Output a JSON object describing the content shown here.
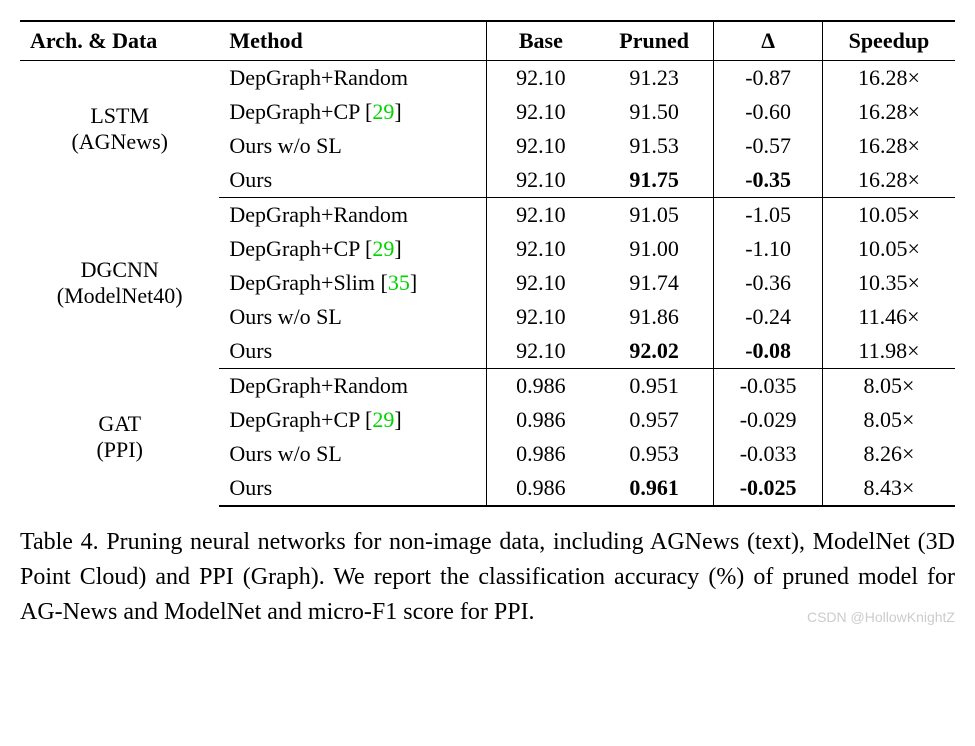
{
  "headers": {
    "arch": "Arch. & Data",
    "method": "Method",
    "base": "Base",
    "pruned": "Pruned",
    "delta": "Δ",
    "speedup": "Speedup"
  },
  "cite29": "29",
  "cite35": "35",
  "groups": [
    {
      "arch_line1": "LSTM",
      "arch_line2": "(AGNews)",
      "rows": [
        {
          "method_pre": "DepGraph+Random",
          "cite": null,
          "method_post": "",
          "base": "92.10",
          "pruned": "91.23",
          "delta": "-0.87",
          "speedup": "16.28×",
          "bold": false
        },
        {
          "method_pre": "DepGraph+CP [",
          "cite": "29",
          "method_post": "]",
          "base": "92.10",
          "pruned": "91.50",
          "delta": "-0.60",
          "speedup": "16.28×",
          "bold": false
        },
        {
          "method_pre": "Ours w/o SL",
          "cite": null,
          "method_post": "",
          "base": "92.10",
          "pruned": "91.53",
          "delta": "-0.57",
          "speedup": "16.28×",
          "bold": false
        },
        {
          "method_pre": "Ours",
          "cite": null,
          "method_post": "",
          "base": "92.10",
          "pruned": "91.75",
          "delta": "-0.35",
          "speedup": "16.28×",
          "bold": true
        }
      ]
    },
    {
      "arch_line1": "DGCNN",
      "arch_line2": "(ModelNet40)",
      "rows": [
        {
          "method_pre": "DepGraph+Random",
          "cite": null,
          "method_post": "",
          "base": "92.10",
          "pruned": "91.05",
          "delta": "-1.05",
          "speedup": "10.05×",
          "bold": false
        },
        {
          "method_pre": "DepGraph+CP [",
          "cite": "29",
          "method_post": "]",
          "base": "92.10",
          "pruned": "91.00",
          "delta": "-1.10",
          "speedup": "10.05×",
          "bold": false
        },
        {
          "method_pre": "DepGraph+Slim [",
          "cite": "35",
          "method_post": "]",
          "base": "92.10",
          "pruned": "91.74",
          "delta": "-0.36",
          "speedup": "10.35×",
          "bold": false
        },
        {
          "method_pre": "Ours w/o SL",
          "cite": null,
          "method_post": "",
          "base": "92.10",
          "pruned": "91.86",
          "delta": "-0.24",
          "speedup": "11.46×",
          "bold": false
        },
        {
          "method_pre": "Ours",
          "cite": null,
          "method_post": "",
          "base": "92.10",
          "pruned": "92.02",
          "delta": "-0.08",
          "speedup": "11.98×",
          "bold": true
        }
      ]
    },
    {
      "arch_line1": "GAT",
      "arch_line2": "(PPI)",
      "rows": [
        {
          "method_pre": "DepGraph+Random",
          "cite": null,
          "method_post": "",
          "base": "0.986",
          "pruned": "0.951",
          "delta": "-0.035",
          "speedup": "8.05×",
          "bold": false
        },
        {
          "method_pre": "DepGraph+CP [",
          "cite": "29",
          "method_post": "]",
          "base": "0.986",
          "pruned": "0.957",
          "delta": "-0.029",
          "speedup": "8.05×",
          "bold": false
        },
        {
          "method_pre": "Ours w/o SL",
          "cite": null,
          "method_post": "",
          "base": "0.986",
          "pruned": "0.953",
          "delta": "-0.033",
          "speedup": "8.26×",
          "bold": false
        },
        {
          "method_pre": "Ours",
          "cite": null,
          "method_post": "",
          "base": "0.986",
          "pruned": "0.961",
          "delta": "-0.025",
          "speedup": "8.43×",
          "bold": true
        }
      ]
    }
  ],
  "caption": "Table 4. Pruning neural networks for non-image data, including AGNews (text), ModelNet (3D Point Cloud) and PPI (Graph). We report the classification accuracy (%) of pruned model for AG-News and ModelNet and micro-F1 score for PPI.",
  "watermark": "CSDN @HollowKnightZ",
  "chart_data": {
    "type": "table",
    "title": "Pruning neural networks for non-image data",
    "columns": [
      "Arch. & Data",
      "Method",
      "Base",
      "Pruned",
      "Delta",
      "Speedup"
    ],
    "rows": [
      [
        "LSTM (AGNews)",
        "DepGraph+Random",
        92.1,
        91.23,
        -0.87,
        "16.28x"
      ],
      [
        "LSTM (AGNews)",
        "DepGraph+CP [29]",
        92.1,
        91.5,
        -0.6,
        "16.28x"
      ],
      [
        "LSTM (AGNews)",
        "Ours w/o SL",
        92.1,
        91.53,
        -0.57,
        "16.28x"
      ],
      [
        "LSTM (AGNews)",
        "Ours",
        92.1,
        91.75,
        -0.35,
        "16.28x"
      ],
      [
        "DGCNN (ModelNet40)",
        "DepGraph+Random",
        92.1,
        91.05,
        -1.05,
        "10.05x"
      ],
      [
        "DGCNN (ModelNet40)",
        "DepGraph+CP [29]",
        92.1,
        91.0,
        -1.1,
        "10.05x"
      ],
      [
        "DGCNN (ModelNet40)",
        "DepGraph+Slim [35]",
        92.1,
        91.74,
        -0.36,
        "10.35x"
      ],
      [
        "DGCNN (ModelNet40)",
        "Ours w/o SL",
        92.1,
        91.86,
        -0.24,
        "11.46x"
      ],
      [
        "DGCNN (ModelNet40)",
        "Ours",
        92.1,
        92.02,
        -0.08,
        "11.98x"
      ],
      [
        "GAT (PPI)",
        "DepGraph+Random",
        0.986,
        0.951,
        -0.035,
        "8.05x"
      ],
      [
        "GAT (PPI)",
        "DepGraph+CP [29]",
        0.986,
        0.957,
        -0.029,
        "8.05x"
      ],
      [
        "GAT (PPI)",
        "Ours w/o SL",
        0.986,
        0.953,
        -0.033,
        "8.26x"
      ],
      [
        "GAT (PPI)",
        "Ours",
        0.986,
        0.961,
        -0.025,
        "8.43x"
      ]
    ]
  }
}
